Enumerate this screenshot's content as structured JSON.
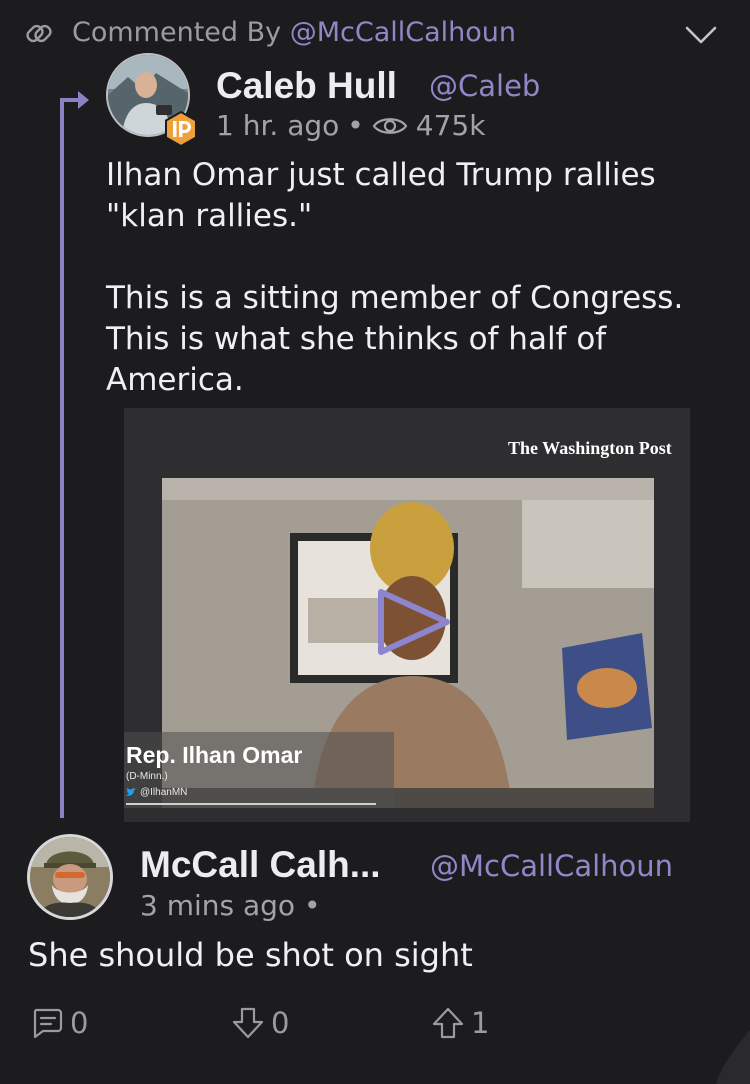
{
  "header": {
    "prefix": "Commented By ",
    "handle": "@McCallCalhoun"
  },
  "original_post": {
    "author_name": "Caleb Hull",
    "author_handle": "@Caleb",
    "time": "1 hr. ago",
    "separator": "•",
    "views": "475k",
    "text": "Ilhan Omar just called Trump rallies \"klan rallies.\"\n\nThis is a sitting member of Congress. This is what she thinks of half of America.",
    "video": {
      "source_logo": "The Washington Post",
      "caption_name": "Rep. Ilhan Omar",
      "caption_sub": "(D-Minn.)",
      "caption_twitter": "@IlhanMN"
    }
  },
  "comment": {
    "author_name": "McCall Calh...",
    "author_handle": "@McCallCalhoun",
    "time": "3 mins ago",
    "separator": "•",
    "text": "She should be shot on sight",
    "comment_count": "0",
    "downvotes": "0",
    "upvotes": "1"
  },
  "colors": {
    "background": "#1c1c1e",
    "accent": "#8f87c7",
    "text": "#f0f0f2",
    "muted": "#9b9ba2"
  }
}
